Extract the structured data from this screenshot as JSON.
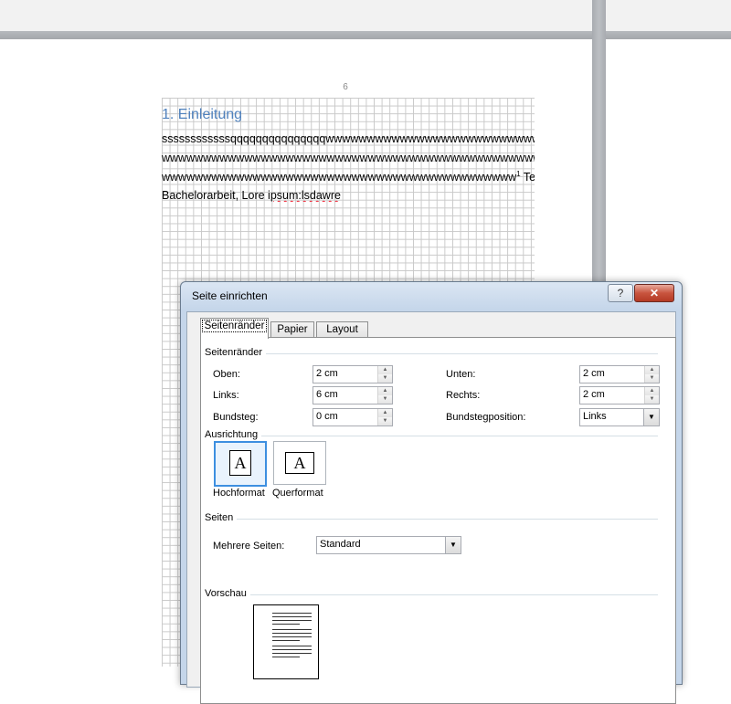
{
  "document": {
    "page_number": "6",
    "heading": "1. Einleitung",
    "line1": "ssssssssssssqqqqqqqqqqqqqqqwwwwwwwwwwwwwwwwwwwwwwwwwwwwwww",
    "line2": "wwwwwwwwwwwwwwwwwwwwwwwwwwwwwwwwwwwwwwwwwwwwwwwwwwwwwwwwwww",
    "line3_main": "wwwwwwwwwwwwwwwwwwwwwwwwwwwwwwwwwwwwwwwwwww",
    "line3_footnote": "1",
    "line3_rest": " Textfür die",
    "line4_a": "Bachelorarbeit, Lore ",
    "line4_b": "ipsum:lsdawre"
  },
  "dialog": {
    "title": "Seite einrichten",
    "help_label": "?",
    "close_label": "✕",
    "tabs": [
      {
        "label": "Seitenränder",
        "active": true
      },
      {
        "label": "Papier",
        "active": false
      },
      {
        "label": "Layout",
        "active": false
      }
    ],
    "margins": {
      "group_label": "Seitenränder",
      "oben_label": "Oben:",
      "oben_value": "2 cm",
      "unten_label": "Unten:",
      "unten_value": "2 cm",
      "links_label": "Links:",
      "links_value": "6 cm",
      "rechts_label": "Rechts:",
      "rechts_value": "2 cm",
      "bundsteg_label": "Bundsteg:",
      "bundsteg_value": "0 cm",
      "bundstegposition_label": "Bundstegposition:",
      "bundstegposition_value": "Links"
    },
    "orientation": {
      "group_label": "Ausrichtung",
      "portrait_label": "Hochformat",
      "landscape_label": "Querformat",
      "icon_letter": "A",
      "selected": "Hochformat"
    },
    "pages": {
      "group_label": "Seiten",
      "multiple_label": "Mehrere Seiten:",
      "multiple_value": "Standard"
    },
    "preview": {
      "group_label": "Vorschau"
    }
  },
  "icons": {
    "spin_up": "▲",
    "spin_down": "▼",
    "dropdown": "▼"
  },
  "colors": {
    "heading": "#4f81bd",
    "selection_border": "#3d8fe0",
    "close_button": "#c8543e"
  }
}
